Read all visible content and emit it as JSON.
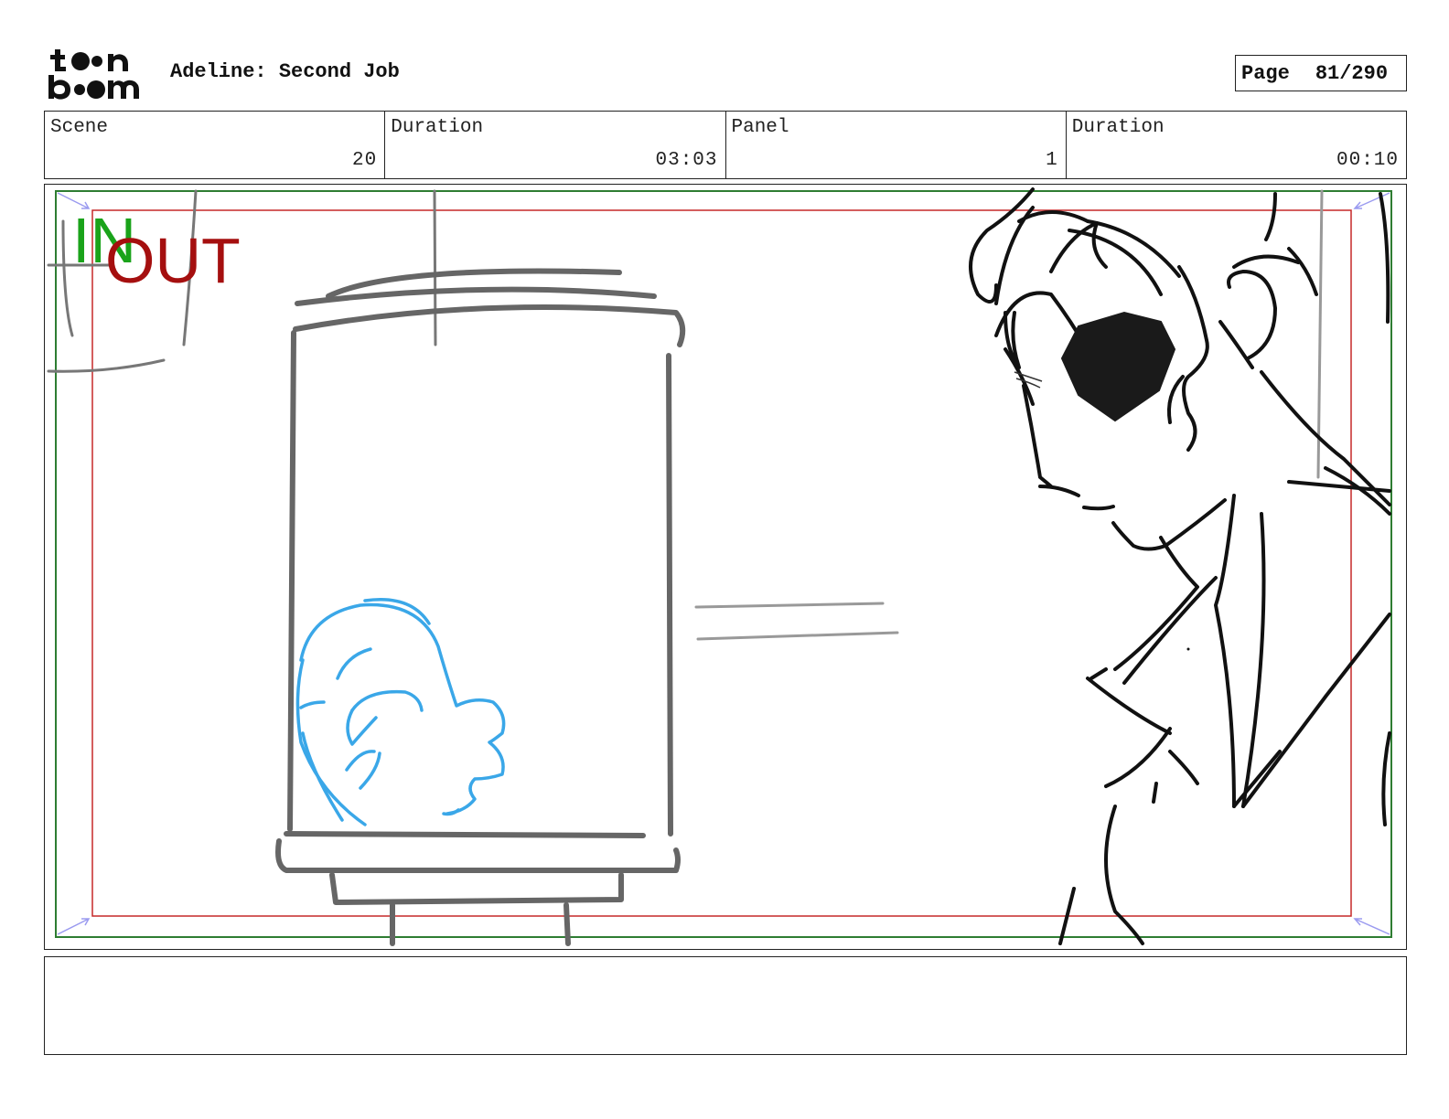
{
  "header": {
    "logo_text": "toon boom",
    "project_title": "Adeline: Second Job",
    "page_label": "Page",
    "page_number": "81/290"
  },
  "info": {
    "scene_label": "Scene",
    "scene_value": "20",
    "scene_duration_label": "Duration",
    "scene_duration_value": "03:03",
    "panel_label": "Panel",
    "panel_value": "1",
    "panel_duration_label": "Duration",
    "panel_duration_value": "00:10"
  },
  "panel": {
    "in_marker": "IN",
    "out_marker": "OUT",
    "colors": {
      "in": "#1aa31a",
      "out": "#a50f0f",
      "safe_frame_green": "#2e7d32",
      "safe_frame_red": "#c62828",
      "sketch_gray": "#666666",
      "sketch_blue": "#3aa7e8",
      "ink": "#111111"
    }
  },
  "notes": {
    "text": ""
  }
}
